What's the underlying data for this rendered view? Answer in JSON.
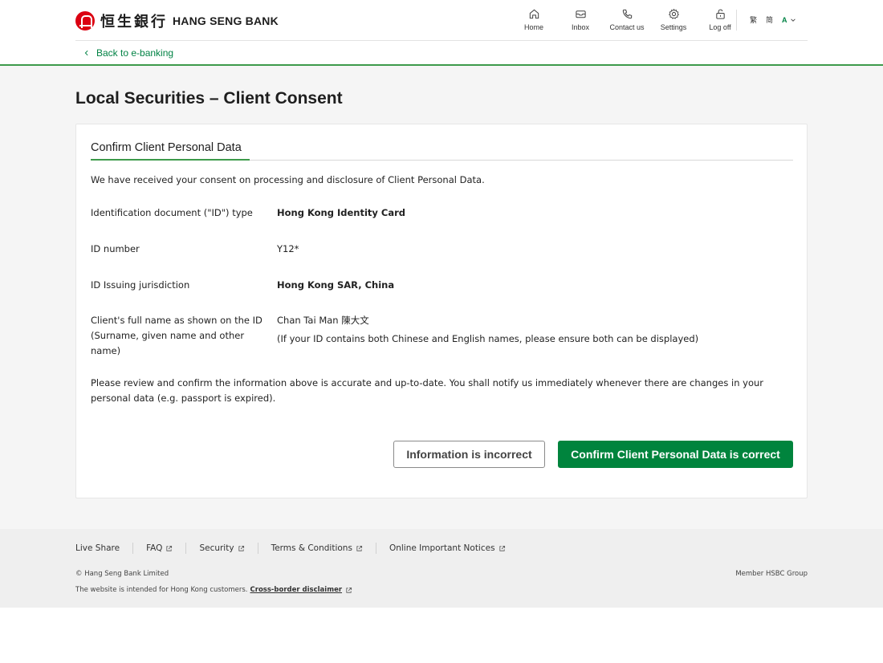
{
  "header": {
    "logo_cn": "恒生銀行",
    "logo_en": "HANG SENG BANK",
    "nav": [
      {
        "label": "Home",
        "icon": "home-icon"
      },
      {
        "label": "Inbox",
        "icon": "inbox-icon"
      },
      {
        "label": "Contact us",
        "icon": "phone-icon"
      },
      {
        "label": "Settings",
        "icon": "gear-icon"
      },
      {
        "label": "Log off",
        "icon": "unlock-icon"
      }
    ],
    "lang_traditional": "繁",
    "lang_simplified": "简",
    "font_size": "A",
    "back_link": "Back to e-banking"
  },
  "page": {
    "title": "Local Securities – Client Consent"
  },
  "card": {
    "section_tab": "Confirm Client Personal Data",
    "intro": "We have received your consent on processing and disclosure of Client Personal Data.",
    "fields": [
      {
        "label": "Identification document (\"ID\") type",
        "value": "Hong Kong Identity Card"
      },
      {
        "label": "ID number",
        "value": "Y12*"
      },
      {
        "label": "ID Issuing jurisdiction",
        "value": "Hong Kong SAR, China"
      },
      {
        "label": "Client's full name as shown on the ID (Surname, given name and other name)",
        "value": "Chan Tai Man 陳大文"
      }
    ],
    "name_note": "(If your ID contains both Chinese and English names, please ensure both can be displayed)",
    "review": "Please review and confirm the information above is accurate and up-to-date. You shall notify us immediately whenever there are changes in your personal data (e.g. passport is expired).",
    "btn_incorrect": "Information is incorrect",
    "btn_confirm": "Confirm Client Personal Data is correct"
  },
  "footer": {
    "links": [
      "Live Share",
      "FAQ",
      "Security",
      "Terms & Conditions",
      "Online Important Notices"
    ],
    "copyright": "© Hang Seng Bank Limited",
    "member": "Member HSBC Group",
    "disclaimer_prefix": "The website is intended for Hong Kong customers.",
    "disclaimer_link": "Cross-border disclaimer"
  },
  "colors": {
    "brand_green": "#00843d",
    "brand_red": "#db0011",
    "accent_rule": "#3d9a4b"
  }
}
